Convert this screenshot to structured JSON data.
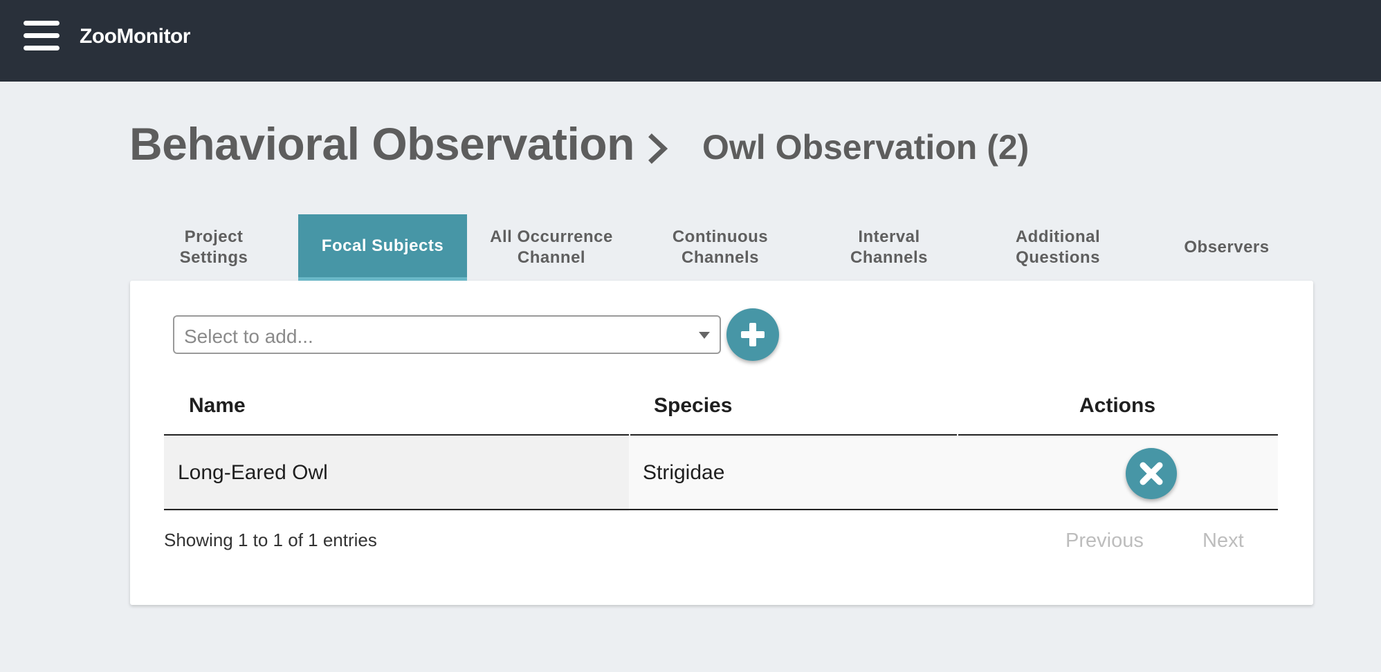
{
  "app": {
    "title": "ZooMonitor",
    "menu_icon": "hamburger-menu-icon"
  },
  "breadcrumb": {
    "main": "Behavioral Observation",
    "separator_icon": "chevron-right-icon",
    "current": "Owl Observation (2)"
  },
  "tabs": [
    {
      "label": "Project\nSettings",
      "active": false
    },
    {
      "label": "Focal Subjects",
      "active": true
    },
    {
      "label": "All Occurrence\nChannel",
      "active": false
    },
    {
      "label": "Continuous\nChannels",
      "active": false
    },
    {
      "label": "Interval\nChannels",
      "active": false
    },
    {
      "label": "Additional\nQuestions",
      "active": false
    },
    {
      "label": "Observers",
      "active": false
    }
  ],
  "add_control": {
    "placeholder": "Select to add...",
    "add_icon": "plus-icon"
  },
  "table": {
    "columns": [
      "Name",
      "Species",
      "Actions"
    ],
    "rows": [
      {
        "name": "Long-Eared Owl",
        "species": "Strigidae",
        "action_icon": "delete-x-icon"
      }
    ],
    "info": "Showing 1 to 1 of 1 entries",
    "pager": {
      "previous": "Previous",
      "next": "Next"
    }
  },
  "colors": {
    "topbar": "#29303a",
    "accent": "#4796a6",
    "background": "#eceff2"
  }
}
